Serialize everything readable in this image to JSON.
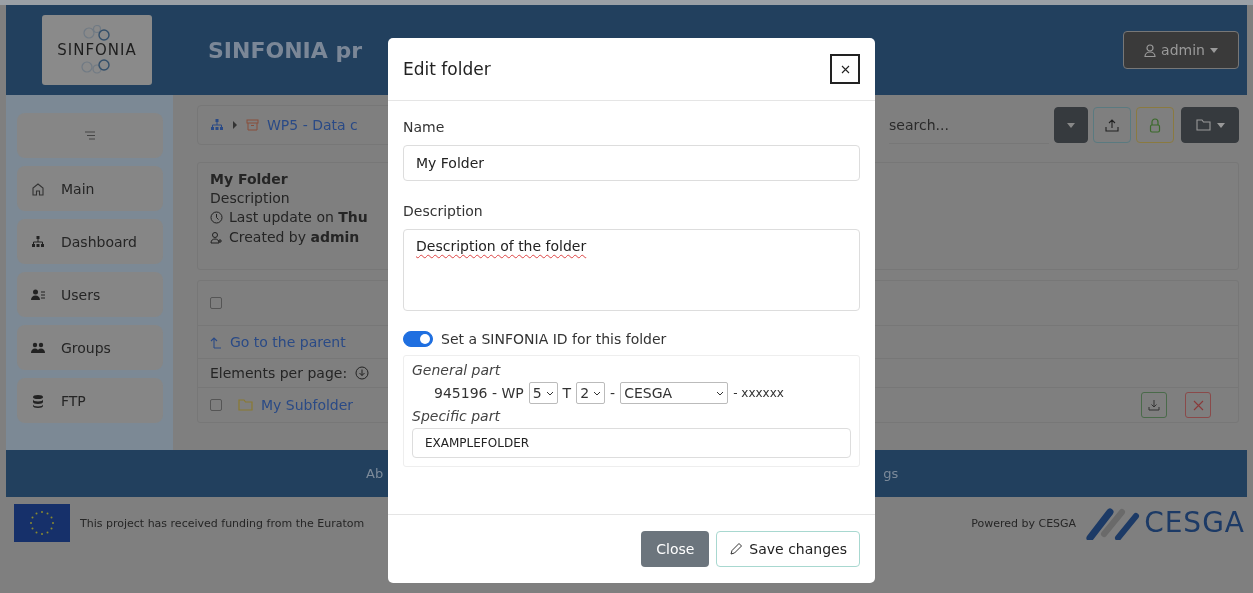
{
  "header": {
    "logo_text": "SINFONIA",
    "title": "SINFONIA pr",
    "user_menu": "admin"
  },
  "sidebar": {
    "items": [
      {
        "label": "Main"
      },
      {
        "label": "Dashboard"
      },
      {
        "label": "Users"
      },
      {
        "label": "Groups"
      },
      {
        "label": "FTP"
      }
    ]
  },
  "breadcrumb": {
    "items": [
      "WP5 - Data c"
    ]
  },
  "search": {
    "placeholder": "search..."
  },
  "folder_info": {
    "name": "My Folder",
    "description": "Description",
    "last_update": "Last update on **Thu**",
    "created": "Created by **admin**"
  },
  "listing": {
    "select_all_checked": false,
    "go_parent": "Go to the parent",
    "per_page": "Elements per page:",
    "rows": [
      {
        "name": "My Subfolder",
        "checked": false
      }
    ]
  },
  "footer": {
    "links": [
      "Ab",
      "gs"
    ],
    "funding": "This project has received funding from the Euratom",
    "powered": "Powered by CESGA",
    "cesga_logo": "CESGA"
  },
  "modal": {
    "title": "Edit folder",
    "name_label": "Name",
    "name_value": "My Folder",
    "description_label": "Description",
    "description_value": "Description of the folder",
    "sinfonia_id": {
      "label": "Set a SINFONIA ID for this folder",
      "on": true
    },
    "general_part_label": "General part",
    "id_prefix": "945196 - WP",
    "wp": "5",
    "t_label": "T",
    "task": "2",
    "separator": "-",
    "organization": "CESGA",
    "suffix": "- xxxxxx",
    "specific_part_label": "Specific part",
    "specific_value": "EXAMPLEFOLDER",
    "buttons": {
      "close": "Close",
      "save": "Save changes"
    }
  }
}
